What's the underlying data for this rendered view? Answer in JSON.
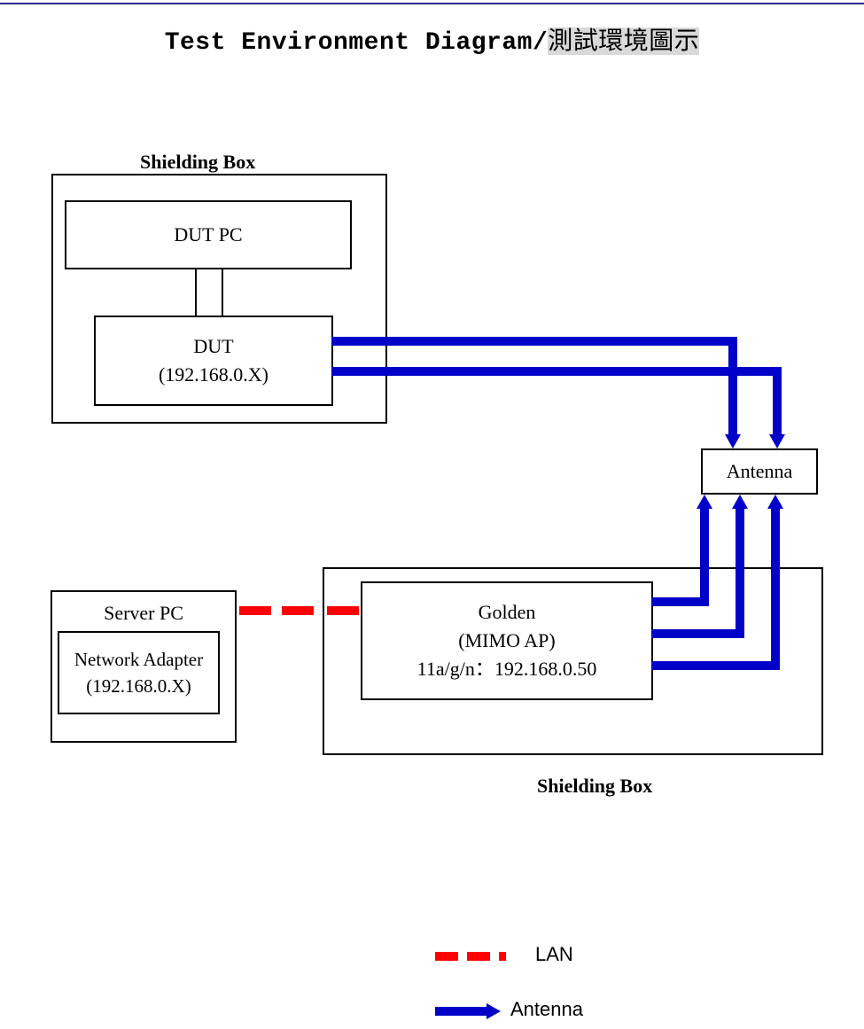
{
  "title_en": "Test Environment Diagram/",
  "title_zh": "測試環境圖示",
  "shield1_label": "Shielding Box",
  "shield2_label": "Shielding Box",
  "dut_pc": "DUT PC",
  "dut_line1": "DUT",
  "dut_line2": "(192.168.0.X)",
  "antenna_box": "Antenna",
  "golden_line1": "Golden",
  "golden_line2": "(MIMO AP)",
  "golden_line3": "11a/g/n：192.168.0.50",
  "server_pc": "Server PC",
  "adapter_line1": "Network Adapter",
  "adapter_line2": "(192.168.0.X)",
  "legend_lan": "LAN",
  "legend_antenna": "Antenna"
}
